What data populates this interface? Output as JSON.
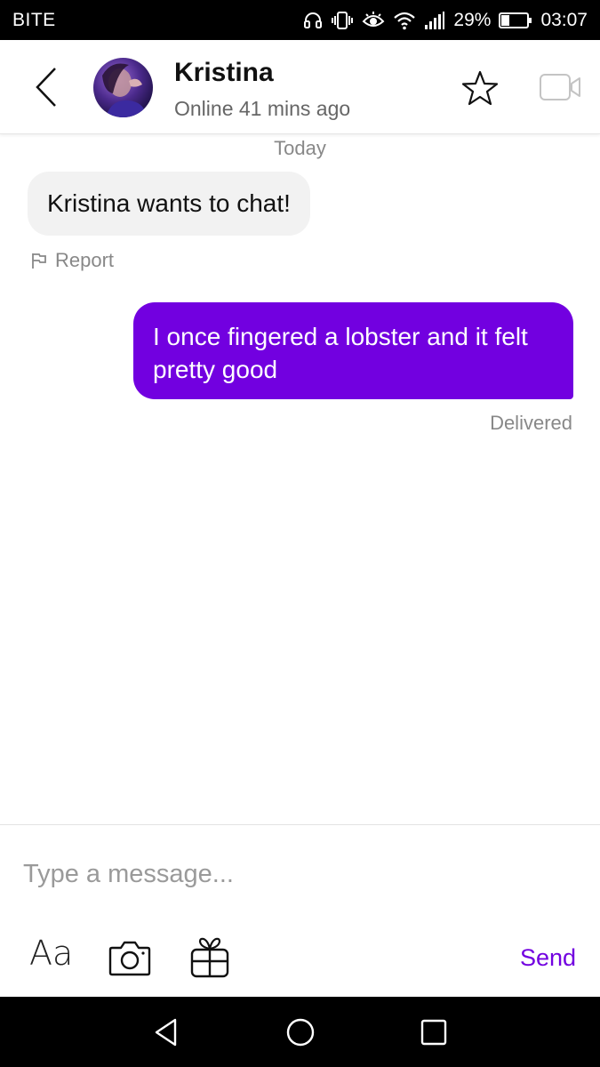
{
  "status_bar": {
    "carrier": "BITE",
    "battery": "29%",
    "time": "03:07",
    "icons": [
      "headphones-icon",
      "vibrate-icon",
      "eye-icon",
      "wifi-icon",
      "signal-icon",
      "battery-icon"
    ]
  },
  "header": {
    "contact_name": "Kristina",
    "contact_status": "Online 41 mins ago",
    "icons": [
      "back-chevron-icon",
      "avatar",
      "star-icon",
      "video-call-icon"
    ]
  },
  "conversation": {
    "date_separator": "Today",
    "incoming_message": "Kristina wants to chat!",
    "report_label": "Report",
    "outgoing_message": "I once fingered a lobster and it felt pretty good",
    "delivery_status": "Delivered"
  },
  "composer": {
    "placeholder": "Type a message...",
    "text_format_label": "Aa",
    "send_label": "Send",
    "icons": [
      "camera-icon",
      "gift-icon"
    ]
  },
  "navigation": {
    "icons": [
      "nav-back-icon",
      "nav-home-icon",
      "nav-recent-apps-icon"
    ]
  },
  "colors": {
    "accent": "#7200e0",
    "incoming_bubble": "#f2f2f2",
    "muted_text": "#888888"
  }
}
